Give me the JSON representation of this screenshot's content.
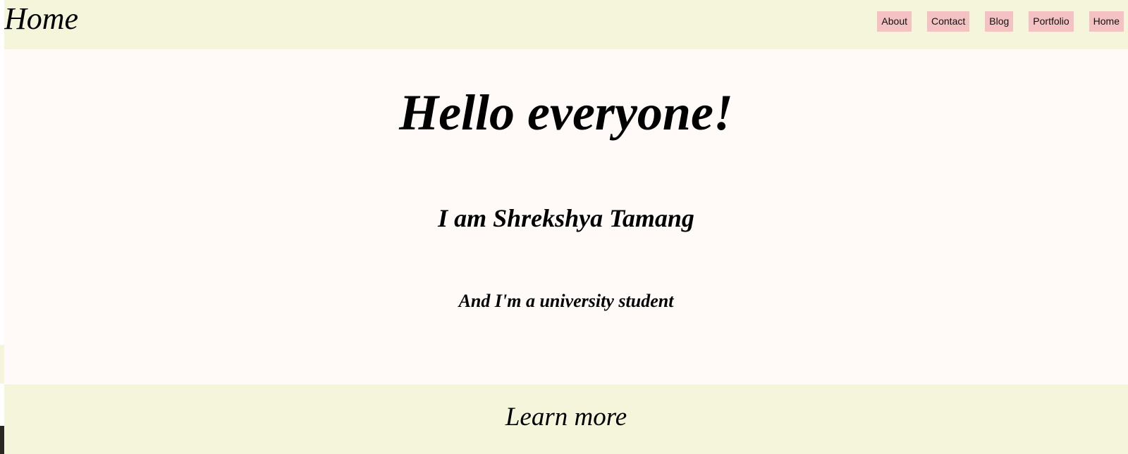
{
  "header": {
    "title": "Home",
    "nav": [
      {
        "label": "About"
      },
      {
        "label": "Contact"
      },
      {
        "label": "Blog"
      },
      {
        "label": "Portfolio"
      },
      {
        "label": "Home"
      }
    ]
  },
  "hero": {
    "title": "Hello everyone!",
    "name": "I am Shrekshya Tamang",
    "tagline": "And I'm a university student"
  },
  "footer": {
    "link": "Learn more"
  },
  "colors": {
    "header_bg": "#f5f5dc",
    "page_bg": "#fffaf7",
    "nav_button_bg": "#f4c2c2"
  }
}
